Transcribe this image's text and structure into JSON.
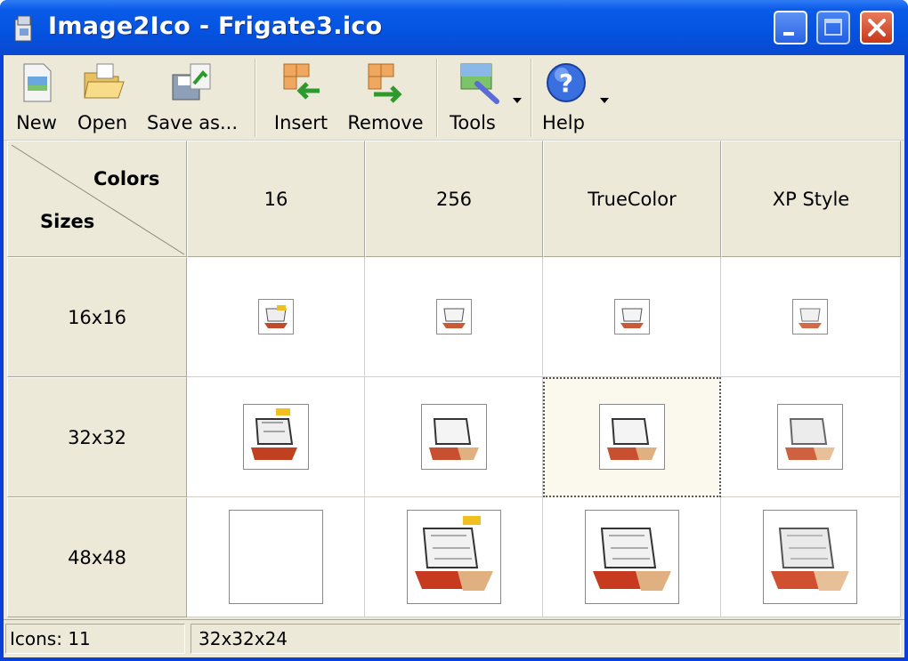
{
  "window": {
    "title": "Image2Ico - Frigate3.ico"
  },
  "toolbar": {
    "new_label": "New",
    "open_label": "Open",
    "save_as_label": "Save as...",
    "insert_label": "Insert",
    "remove_label": "Remove",
    "tools_label": "Tools",
    "help_label": "Help"
  },
  "grid": {
    "corner_colors": "Colors",
    "corner_sizes": "Sizes",
    "columns": [
      "16",
      "256",
      "TrueColor",
      "XP Style"
    ],
    "rows": [
      "16x16",
      "32x32",
      "48x48"
    ],
    "selected_cell": "32x32 / TrueColor",
    "empty_cell": "48x48 / 16"
  },
  "statusbar": {
    "icons_count": "Icons: 11",
    "selection_info": "32x32x24"
  },
  "colors": {
    "titlebar": "#0a5ae8",
    "face": "#ece9d8",
    "close_button": "#c7391a"
  }
}
